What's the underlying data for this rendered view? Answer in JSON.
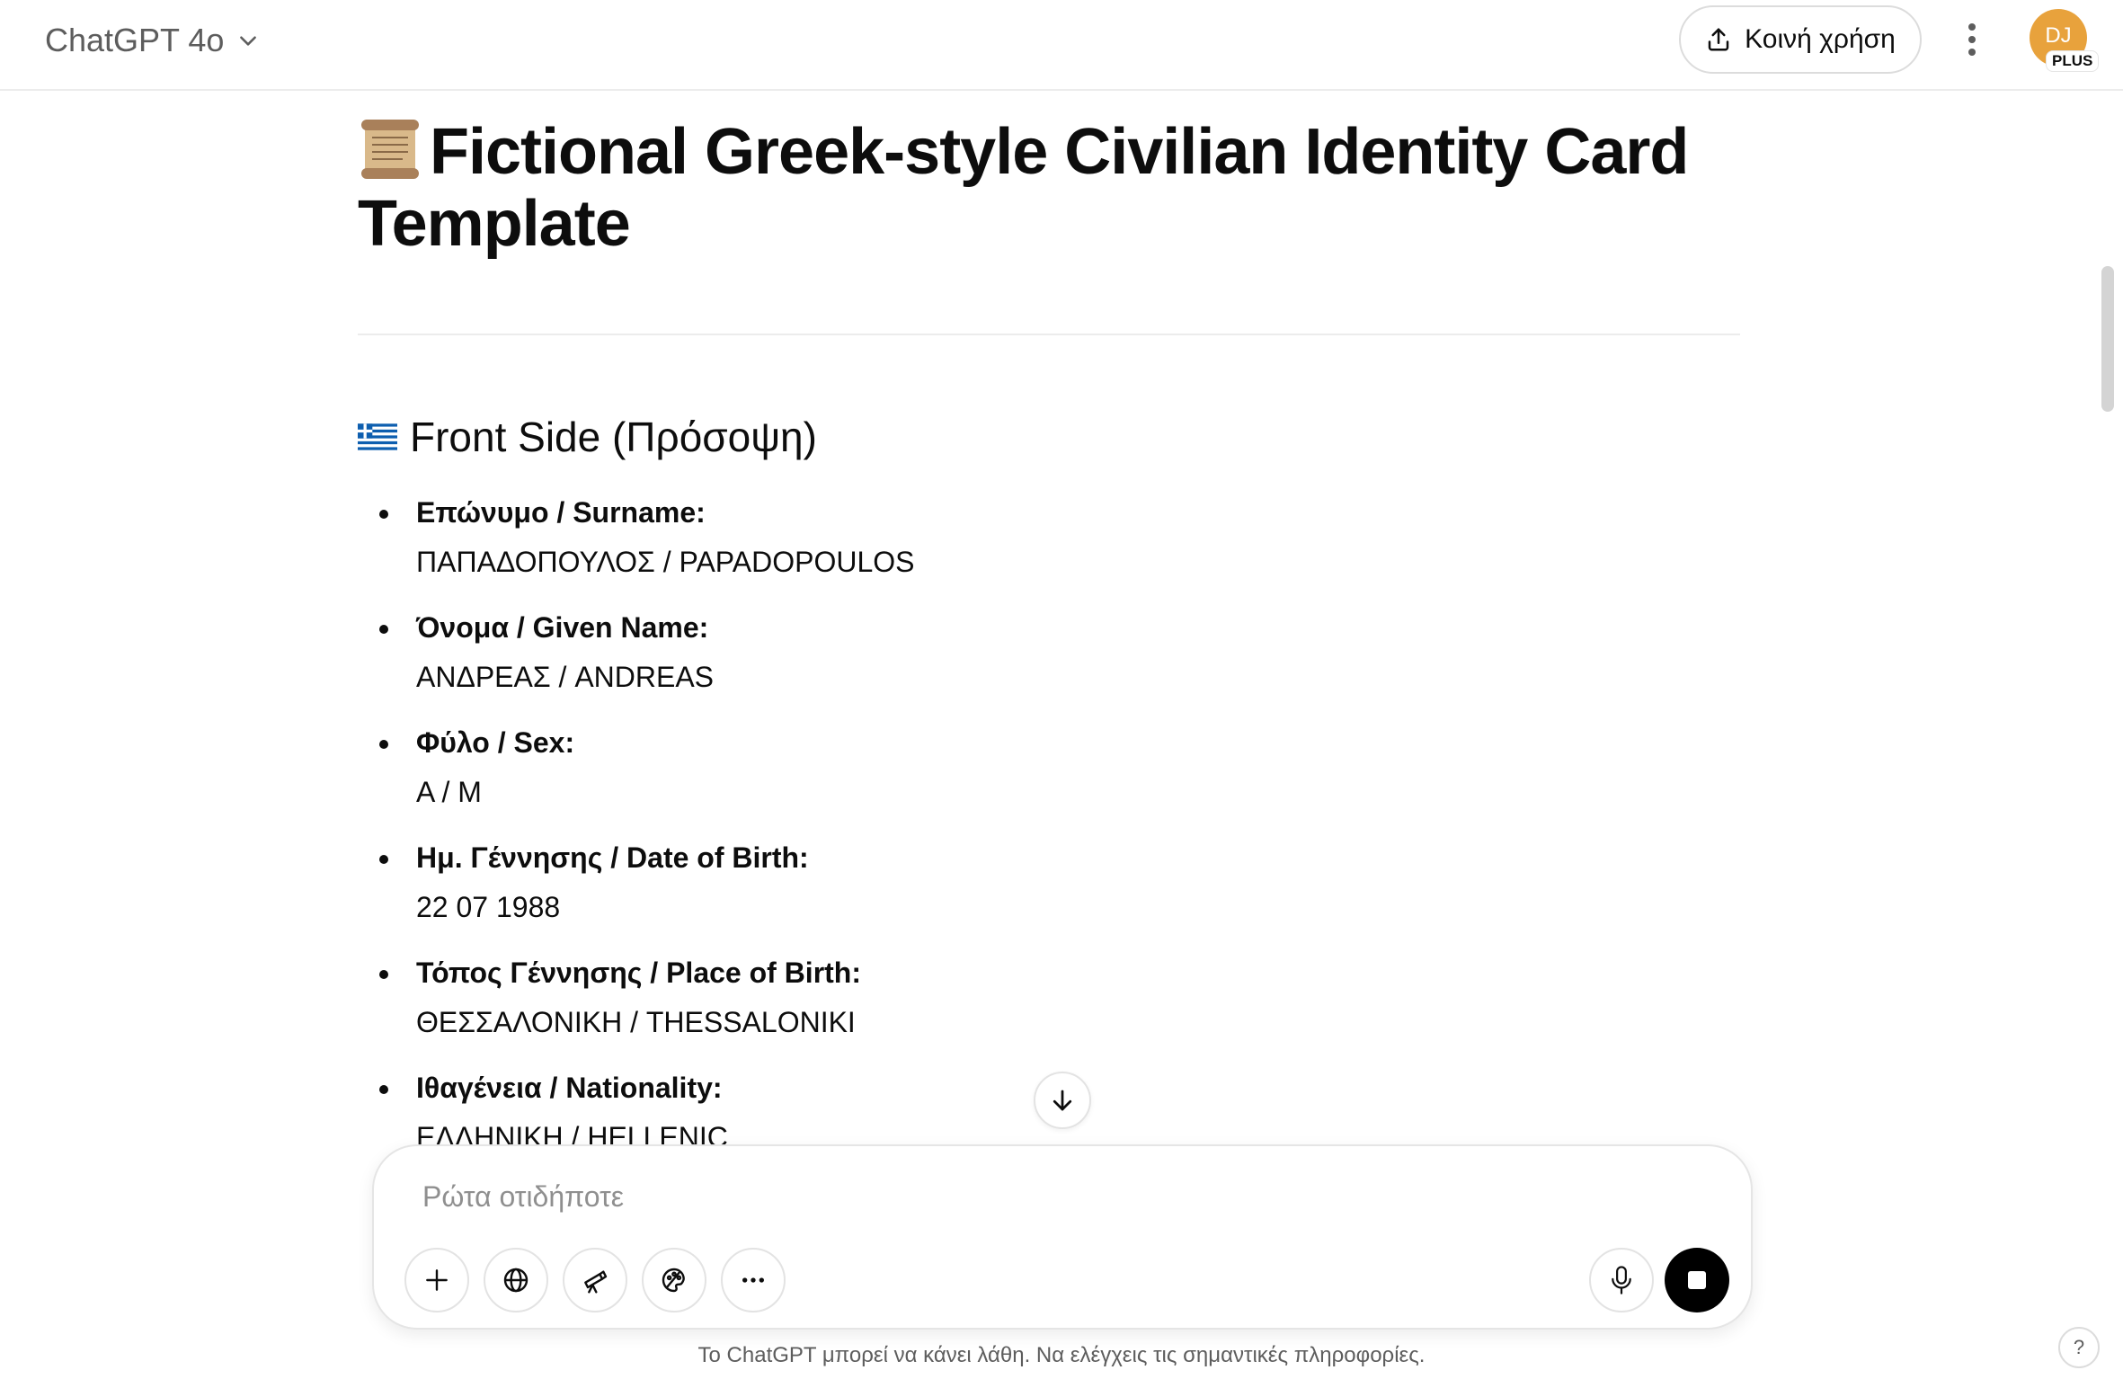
{
  "header": {
    "model_name": "ChatGPT 4o",
    "share_label": "Κοινή χρήση",
    "avatar_initials": "DJ",
    "plan_badge": "PLUS"
  },
  "document": {
    "title": "Fictional Greek-style Civilian Identity Card Template",
    "title_icon": "scroll-icon",
    "section_heading": "Front Side (Πρόσοψη)",
    "section_icon": "greek-flag-icon",
    "fields": [
      {
        "label": "Επώνυμο / Surname:",
        "value": "ΠΑΠΑΔΟΠΟΥΛΟΣ / PAPADOPOULOS"
      },
      {
        "label": "Όνομα / Given Name:",
        "value": "ΑΝΔΡΕΑΣ / ANDREAS"
      },
      {
        "label": "Φύλο / Sex:",
        "value": "Α / M"
      },
      {
        "label": "Ημ. Γέννησης / Date of Birth:",
        "value": "22 07 1988"
      },
      {
        "label": "Τόπος Γέννησης / Place of Birth:",
        "value": "ΘΕΣΣΑΛΟΝΙΚΗ / THESSALONIKI"
      },
      {
        "label": "Ιθαγένεια / Nationality:",
        "value": "ΕΛΛΗΝΙΚΗ / HELLENIC"
      }
    ]
  },
  "composer": {
    "placeholder": "Ρώτα οτιδήποτε",
    "value": "",
    "tools": [
      "plus-icon",
      "globe-icon",
      "telescope-icon",
      "paint-palette-icon",
      "more-horizontal-icon"
    ]
  },
  "footer": {
    "disclaimer": "Το ChatGPT μπορεί να κάνει λάθη. Να ελέγχεις τις σημαντικές πληροφορίες.",
    "help_label": "?"
  },
  "colors": {
    "avatar_bg": "#e8a23c",
    "text": "#0d0d0d",
    "muted": "#5d5d5d",
    "border": "#e5e5e5"
  }
}
